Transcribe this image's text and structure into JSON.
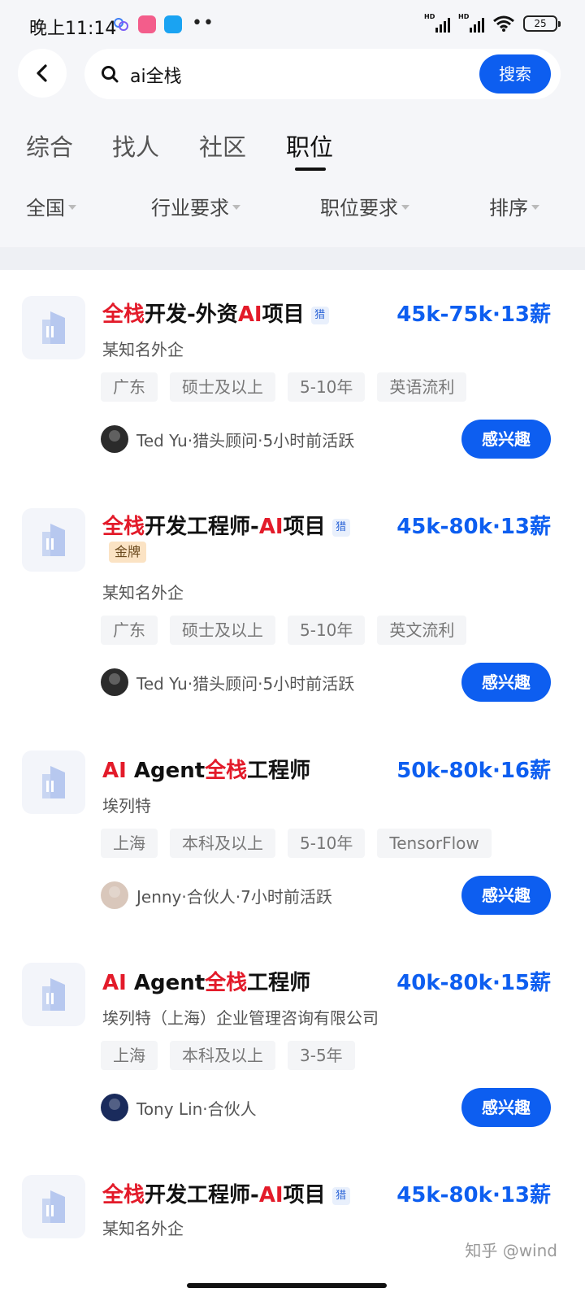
{
  "status_bar": {
    "time": "晚上11:14",
    "dots": "••",
    "battery": "25",
    "hd": "HD"
  },
  "search": {
    "query": "ai全栈",
    "button": "搜索"
  },
  "tabs": [
    {
      "label": "综合"
    },
    {
      "label": "找人"
    },
    {
      "label": "社区"
    },
    {
      "label": "职位",
      "active": true
    }
  ],
  "filters": [
    {
      "label": "全国"
    },
    {
      "label": "行业要求"
    },
    {
      "label": "职位要求"
    },
    {
      "label": "排序"
    }
  ],
  "jobs": [
    {
      "title_parts": [
        "全栈",
        "开发-外资",
        "AI",
        "项目"
      ],
      "badge": "猎",
      "salary": "45k-75k·13薪",
      "company": "某知名外企",
      "tags": [
        "广东",
        "硕士及以上",
        "5-10年",
        "英语流利"
      ],
      "recruiter": "Ted Yu·猎头顾问·5小时前活跃",
      "button": "感兴趣"
    },
    {
      "title_parts": [
        "全栈",
        "开发工程师-",
        "AI",
        "项目"
      ],
      "badge": "猎",
      "gold": "金牌",
      "salary": "45k-80k·13薪",
      "company": "某知名外企",
      "tags": [
        "广东",
        "硕士及以上",
        "5-10年",
        "英文流利"
      ],
      "recruiter": "Ted Yu·猎头顾问·5小时前活跃",
      "button": "感兴趣"
    },
    {
      "title_parts": [
        "AI",
        " Agent",
        "全栈",
        "工程师"
      ],
      "salary": "50k-80k·16薪",
      "company": "埃列特",
      "tags": [
        "上海",
        "本科及以上",
        "5-10年",
        "TensorFlow"
      ],
      "recruiter": "Jenny·合伙人·7小时前活跃",
      "button": "感兴趣"
    },
    {
      "title_parts": [
        "AI",
        " Agent",
        "全栈",
        "工程师"
      ],
      "salary": "40k-80k·15薪",
      "company": "埃列特（上海）企业管理咨询有限公司",
      "tags": [
        "上海",
        "本科及以上",
        "3-5年"
      ],
      "recruiter": "Tony Lin·合伙人",
      "button": "感兴趣"
    },
    {
      "title_parts": [
        "全栈",
        "开发工程师-",
        "AI",
        "项目"
      ],
      "badge": "猎",
      "salary": "45k-80k·13薪",
      "company": "某知名外企"
    }
  ],
  "watermark": "知乎 @wind",
  "colors": {
    "accent": "#0d5ef0",
    "highlight": "#e31b2a"
  }
}
